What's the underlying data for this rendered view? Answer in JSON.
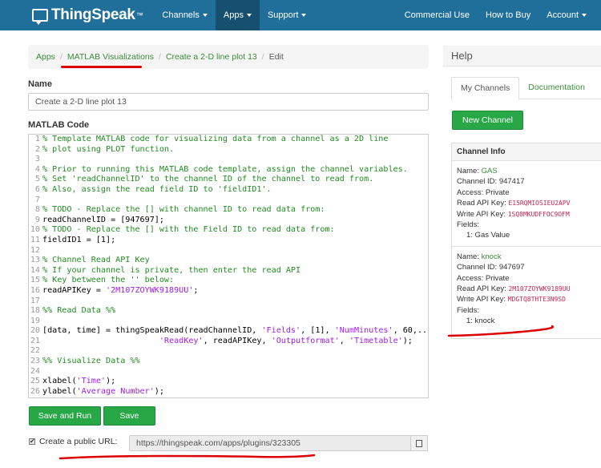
{
  "navbar": {
    "brand": "ThingSpeak",
    "trademark": "™",
    "left_items": [
      {
        "label": "Channels",
        "active": false
      },
      {
        "label": "Apps",
        "active": true
      },
      {
        "label": "Support",
        "active": false
      }
    ],
    "right_items": [
      {
        "label": "Commercial Use",
        "caret": false
      },
      {
        "label": "How to Buy",
        "caret": false
      },
      {
        "label": "Account",
        "caret": true
      }
    ]
  },
  "breadcrumb": {
    "items": [
      "Apps",
      "MATLAB Visualizations",
      "Create a 2-D line plot 13"
    ],
    "current": "Edit",
    "separator": "/"
  },
  "form": {
    "name_label": "Name",
    "name_value": "Create a 2-D line plot 13",
    "code_label": "MATLAB Code",
    "code_lines": [
      {
        "n": "1",
        "segs": [
          {
            "t": "% Template MATLAB code for visualizing data from a channel as a 2D line",
            "c": "comment"
          }
        ]
      },
      {
        "n": "2",
        "segs": [
          {
            "t": "% plot using PLOT function.",
            "c": "comment"
          }
        ]
      },
      {
        "n": "3",
        "segs": []
      },
      {
        "n": "4",
        "segs": [
          {
            "t": "% Prior to running this MATLAB code template, assign the channel variables.",
            "c": "comment"
          }
        ]
      },
      {
        "n": "5",
        "segs": [
          {
            "t": "% Set 'readChannelID' to the channel ID of the channel to read from.",
            "c": "comment"
          }
        ]
      },
      {
        "n": "6",
        "segs": [
          {
            "t": "% Also, assign the read field ID to 'fieldID1'.",
            "c": "comment"
          }
        ]
      },
      {
        "n": "7",
        "segs": []
      },
      {
        "n": "8",
        "segs": [
          {
            "t": "% TODO - Replace the [] with channel ID to read data from:",
            "c": "comment"
          }
        ]
      },
      {
        "n": "9",
        "segs": [
          {
            "t": "readChannelID = [947697];",
            "c": ""
          }
        ]
      },
      {
        "n": "10",
        "segs": [
          {
            "t": "% TODO - Replace the [] with the Field ID to read data from:",
            "c": "comment"
          }
        ]
      },
      {
        "n": "11",
        "segs": [
          {
            "t": "fieldID1 = [1];",
            "c": ""
          }
        ]
      },
      {
        "n": "12",
        "segs": []
      },
      {
        "n": "13",
        "segs": [
          {
            "t": "% Channel Read API Key",
            "c": "comment"
          }
        ]
      },
      {
        "n": "14",
        "segs": [
          {
            "t": "% If your channel is private, then enter the read API",
            "c": "comment"
          }
        ]
      },
      {
        "n": "15",
        "segs": [
          {
            "t": "% Key between the '' below:",
            "c": "comment"
          }
        ]
      },
      {
        "n": "16",
        "segs": [
          {
            "t": "readAPIKey = ",
            "c": ""
          },
          {
            "t": "'2M107ZOYWK9189UU'",
            "c": "str"
          },
          {
            "t": ";",
            "c": ""
          }
        ]
      },
      {
        "n": "17",
        "segs": []
      },
      {
        "n": "18",
        "segs": [
          {
            "t": "%% Read Data %%",
            "c": "comment"
          }
        ]
      },
      {
        "n": "19",
        "segs": []
      },
      {
        "n": "20",
        "segs": [
          {
            "t": "[data, time] = thingSpeakRead(readChannelID, ",
            "c": ""
          },
          {
            "t": "'Fields'",
            "c": "str"
          },
          {
            "t": ", [1], ",
            "c": ""
          },
          {
            "t": "'NumMinutes'",
            "c": "str"
          },
          {
            "t": ", 60,...",
            "c": ""
          }
        ]
      },
      {
        "n": "21",
        "segs": [
          {
            "t": "                        ",
            "c": ""
          },
          {
            "t": "'ReadKey'",
            "c": "str"
          },
          {
            "t": ", readAPIKey, ",
            "c": ""
          },
          {
            "t": "'Outputformat'",
            "c": "str"
          },
          {
            "t": ", ",
            "c": ""
          },
          {
            "t": "'Timetable'",
            "c": "str"
          },
          {
            "t": ");",
            "c": ""
          }
        ]
      },
      {
        "n": "22",
        "segs": []
      },
      {
        "n": "23",
        "segs": [
          {
            "t": "%% Visualize Data %%",
            "c": "comment"
          }
        ]
      },
      {
        "n": "24",
        "segs": []
      },
      {
        "n": "25",
        "segs": [
          {
            "t": "xlabel(",
            "c": ""
          },
          {
            "t": "'Time'",
            "c": "str"
          },
          {
            "t": ");",
            "c": ""
          }
        ]
      },
      {
        "n": "26",
        "segs": [
          {
            "t": "ylabel(",
            "c": ""
          },
          {
            "t": "'Average Number'",
            "c": "str"
          },
          {
            "t": ");",
            "c": ""
          }
        ]
      }
    ],
    "save_and_run_label": "Save and Run",
    "save_label": "Save",
    "public_url_checked": true,
    "public_url_label": "Create a public URL:",
    "public_url_value": "https://thingspeak.com/apps/plugins/323305"
  },
  "help": {
    "title": "Help",
    "tabs": [
      {
        "label": "My Channels",
        "active": true
      },
      {
        "label": "Documentation",
        "active": false
      }
    ],
    "new_channel_label": "New Channel",
    "channel_info_title": "Channel Info",
    "channels": [
      {
        "name_label": "Name:",
        "name": "GAS",
        "id_label": "Channel ID:",
        "id": "947417",
        "access_label": "Access:",
        "access": "Private",
        "read_key_label": "Read API Key:",
        "read_key": "E15RQMIOSIEU2APV",
        "write_key_label": "Write API Key:",
        "write_key": "1SQ8MKUDFFOC9OFM",
        "fields_label": "Fields:",
        "fields": [
          "1: Gas Value"
        ]
      },
      {
        "name_label": "Name:",
        "name": "knock",
        "id_label": "Channel ID:",
        "id": "947697",
        "access_label": "Access:",
        "access": "Private",
        "read_key_label": "Read API Key:",
        "read_key": "2M107ZOYWK9189UU",
        "write_key_label": "Write API Key:",
        "write_key": "MDGTQ8THTE3N9SD",
        "fields_label": "Fields:",
        "fields": [
          "1: knock"
        ]
      }
    ]
  },
  "colors": {
    "navbar": "#1f6f9a",
    "nav_active": "#164f70",
    "accent_green": "#27a745",
    "link_green": "#3c8d3c",
    "comment": "#228b22",
    "string": "#a020f0",
    "api_key": "#c7254e",
    "annotation_red": "#dd0000"
  }
}
